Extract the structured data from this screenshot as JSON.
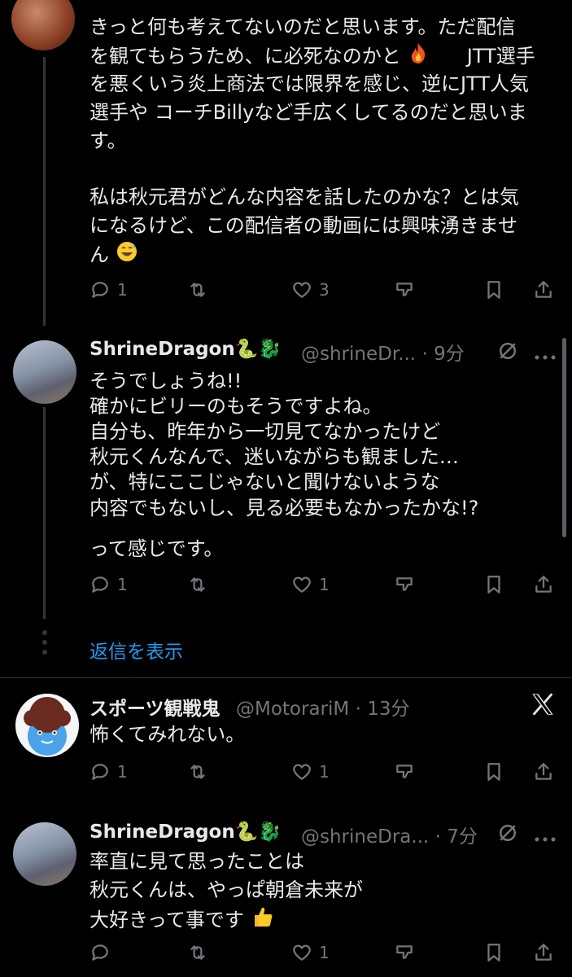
{
  "post1": {
    "lines": [
      "きっと何も考えてないのだと思います。ただ配信",
      "を観てもらうため、に必死なのかと",
      "JTT選手",
      "を悪くいう炎上商法では限界を感じ、逆にJTT人気",
      "選手や コーチBillyなど手広くしてるのだと思いま",
      "す。",
      "",
      "私は秋元君がどんな内容を話したのかな？とは気",
      "になるけど、この配信者の動画には興味湧きませ",
      "ん"
    ],
    "emoji_fire": "fire",
    "emoji_sweat": "grinning-sweat",
    "actions": {
      "replies": "1",
      "retweets": "",
      "likes": "3"
    }
  },
  "post2": {
    "name": "ShrineDragon🐍🐉",
    "handle": "@shrineDr...",
    "dot": "·",
    "time": "9分",
    "lines": [
      "そうでしょうね!!",
      "確かにビリーのもそうですよね。",
      "自分も、昨年から一切見てなかったけど",
      "秋元くんなんで、迷いながらも観ました…",
      "が、特にここじゃないと聞けないような",
      "内容でもないし、見る必要もなかったかな!?",
      "って感じです。"
    ],
    "actions": {
      "replies": "1",
      "retweets": "",
      "likes": "1"
    }
  },
  "show_replies": "返信を表示",
  "post3": {
    "name": "スポーツ観戦鬼",
    "handle": "@MotorariM",
    "dot": "·",
    "time": "13分",
    "text": "怖くてみれない。",
    "actions": {
      "replies": "1",
      "retweets": "",
      "likes": "1"
    }
  },
  "post4": {
    "name": "ShrineDragon🐍🐉",
    "handle": "@shrineDra...",
    "dot": "·",
    "time": "7分",
    "lines": [
      "率直に見て思ったことは",
      "秋元くんは、やっぱ朝倉未来が",
      "大好きって事です"
    ],
    "emoji_thumb": "thumbs-up",
    "actions": {
      "replies": "",
      "retweets": "",
      "likes": "1"
    }
  },
  "colors": {
    "bg": "#000000",
    "text": "#e7e9ea",
    "muted": "#71767b",
    "link": "#1d9bf0",
    "line": "#333639"
  }
}
